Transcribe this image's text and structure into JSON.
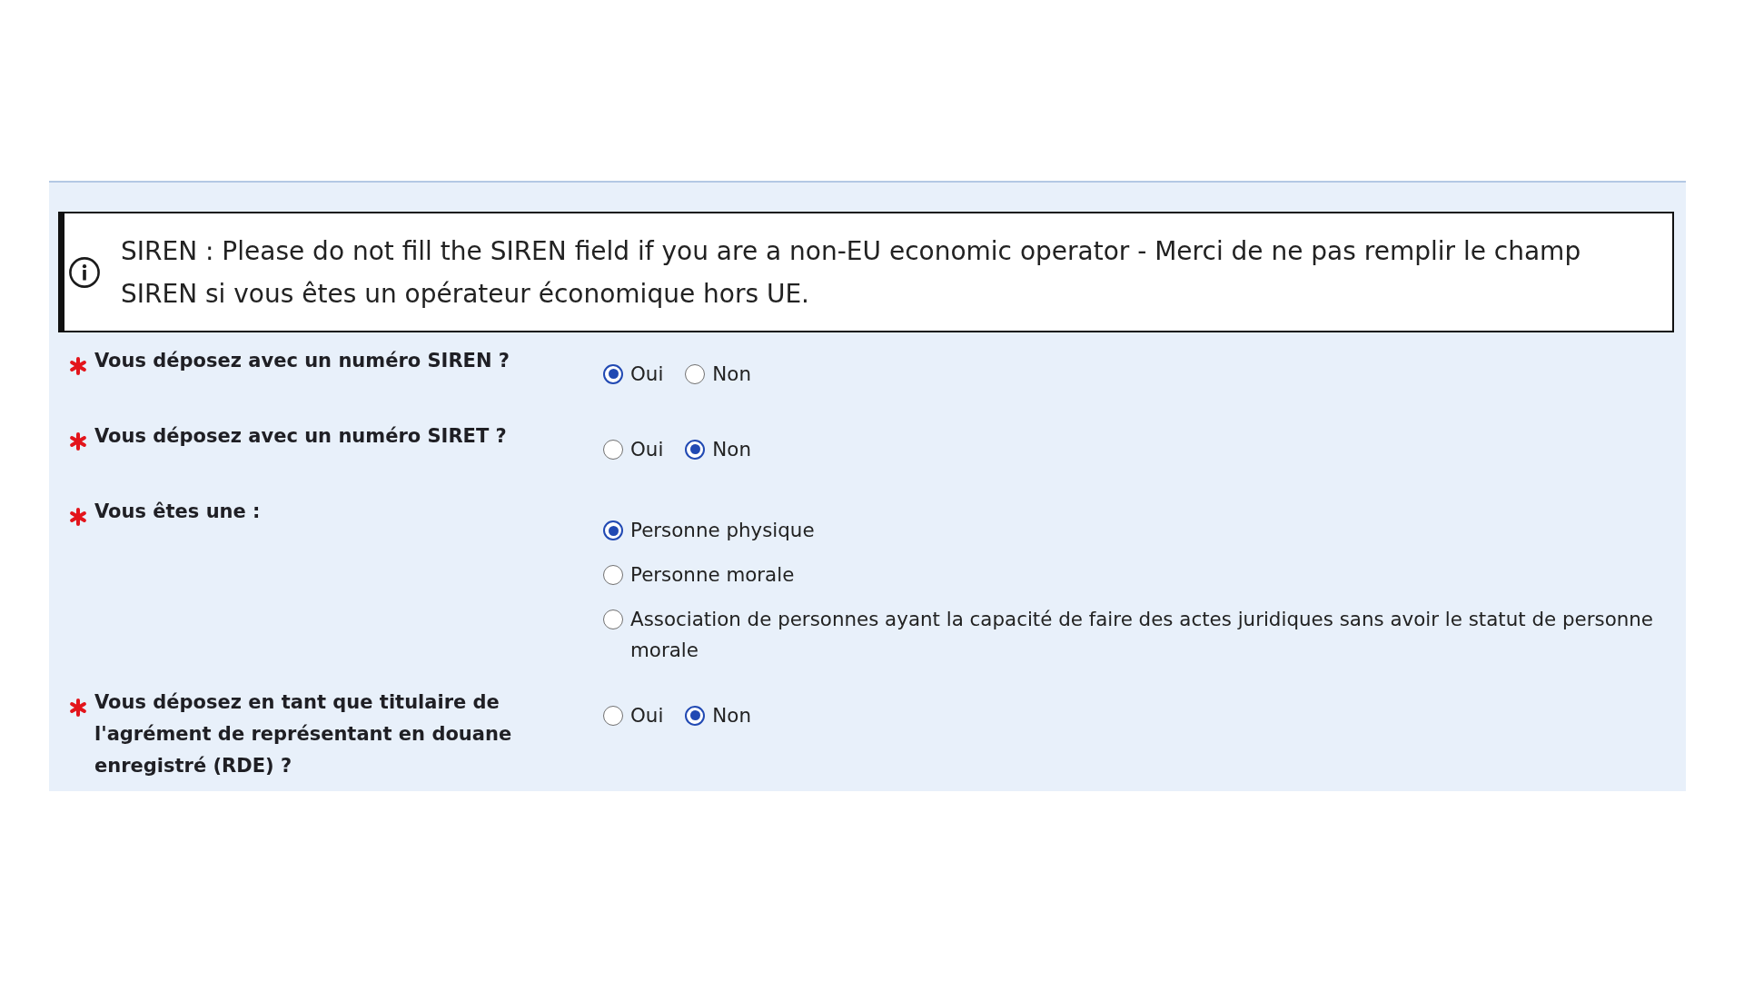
{
  "notice": {
    "text": "SIREN : Please do not fill the SIREN field if you are a non-EU economic operator - Merci de ne pas remplir le champ SIREN si vous êtes un opérateur économique hors UE."
  },
  "questions": [
    {
      "label": "Vous déposez avec un numéro SIREN ?",
      "required": true,
      "kind": "inline",
      "options": [
        {
          "label": "Oui",
          "selected": true
        },
        {
          "label": "Non",
          "selected": false
        }
      ]
    },
    {
      "label": "Vous déposez avec un numéro SIRET ?",
      "required": true,
      "kind": "inline",
      "options": [
        {
          "label": "Oui",
          "selected": false
        },
        {
          "label": "Non",
          "selected": true
        }
      ]
    },
    {
      "label": "Vous êtes une :",
      "required": true,
      "kind": "stacked",
      "options": [
        {
          "label": "Personne physique",
          "selected": true
        },
        {
          "label": "Personne morale",
          "selected": false
        },
        {
          "label": "Association de personnes ayant la capacité de faire des actes juridiques sans avoir le statut de personne morale",
          "selected": false
        }
      ]
    },
    {
      "label": "Vous déposez en tant que titulaire de l'agrément de représentant en douane enregistré (RDE) ?",
      "required": true,
      "kind": "inline",
      "options": [
        {
          "label": "Oui",
          "selected": false
        },
        {
          "label": "Non",
          "selected": true
        }
      ]
    }
  ]
}
